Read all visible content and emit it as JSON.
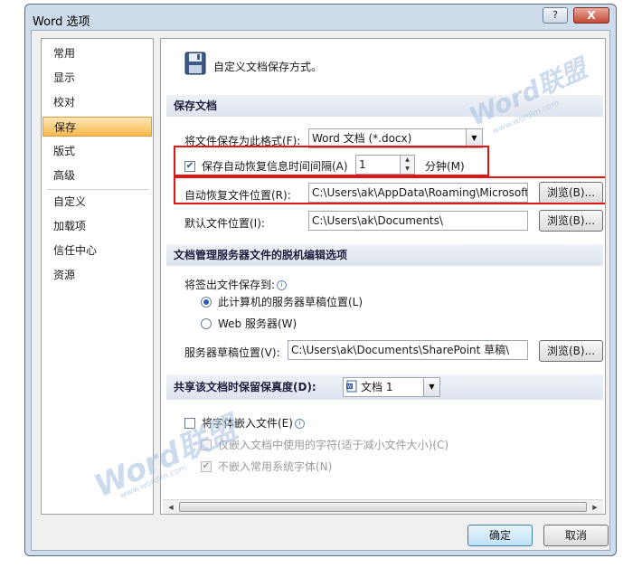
{
  "window": {
    "title": "Word 选项",
    "help_label": "?",
    "close_label": "X"
  },
  "sidebar": {
    "items": [
      {
        "label": "常用"
      },
      {
        "label": "显示"
      },
      {
        "label": "校对"
      },
      {
        "label": "保存",
        "active": true
      },
      {
        "label": "版式"
      },
      {
        "label": "高级"
      },
      {
        "label": "自定义"
      },
      {
        "label": "加载项"
      },
      {
        "label": "信任中心"
      },
      {
        "label": "资源"
      }
    ]
  },
  "header": {
    "icon": "floppy-disk-icon",
    "title": "自定义文档保存方式。"
  },
  "save_docs": {
    "section_title": "保存文档",
    "format_label": "将文件保存为此格式(F):",
    "format_value": "Word 文档 (*.docx)",
    "autorecover_checked": true,
    "autorecover_label": "保存自动恢复信息时间间隔(A)",
    "autorecover_minutes": "1",
    "minutes_label": "分钟(M)",
    "autorecover_location_label": "自动恢复文件位置(R):",
    "autorecover_location_value": "C:\\Users\\ak\\AppData\\Roaming\\Microsoft",
    "default_location_label": "默认文件位置(I):",
    "default_location_value": "C:\\Users\\ak\\Documents\\",
    "browse_label": "浏览(B)..."
  },
  "offline": {
    "section_title": "文档管理服务器文件的脱机编辑选项",
    "saveto_label": "将签出文件保存到:",
    "option_local": "此计算机的服务器草稿位置(L)",
    "option_web": "Web 服务器(W)",
    "selected": "local",
    "drafts_label": "服务器草稿位置(V):",
    "drafts_value": "C:\\Users\\ak\\Documents\\SharePoint 草稿\\",
    "browse_label": "浏览(B)..."
  },
  "fidelity": {
    "section_title": "共享该文档时保留保真度(D):",
    "document_value": "文档 1",
    "embed_fonts_label": "将字体嵌入文件(E)",
    "embed_fonts_checked": false,
    "embed_used_label": "仅嵌入文档中使用的字符(适于减小文件大小)(C)",
    "embed_used_checked": false,
    "no_common_label": "不嵌入常用系统字体(N)",
    "no_common_checked": true
  },
  "footer": {
    "ok_label": "确定",
    "cancel_label": "取消"
  },
  "watermarks": {
    "brand": "Word联盟",
    "url": "www.wordlm.com"
  },
  "colors": {
    "highlight_box": "#e01515",
    "active_nav": "#f8b94d"
  }
}
